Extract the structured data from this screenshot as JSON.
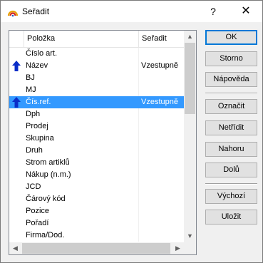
{
  "window": {
    "title": "Seřadit",
    "help": "?",
    "close": "✕"
  },
  "list": {
    "headers": {
      "item": "Položka",
      "sort": "Seřadit"
    },
    "rows": [
      {
        "item": "Číslo art.",
        "sort": "",
        "arrow": false,
        "selected": false
      },
      {
        "item": "Název",
        "sort": "Vzestupně",
        "arrow": true,
        "selected": false
      },
      {
        "item": "BJ",
        "sort": "",
        "arrow": false,
        "selected": false
      },
      {
        "item": "MJ",
        "sort": "",
        "arrow": false,
        "selected": false
      },
      {
        "item": "Čís.ref.",
        "sort": "Vzestupně",
        "arrow": true,
        "selected": true
      },
      {
        "item": "Dph",
        "sort": "",
        "arrow": false,
        "selected": false
      },
      {
        "item": "Prodej",
        "sort": "",
        "arrow": false,
        "selected": false
      },
      {
        "item": "Skupina",
        "sort": "",
        "arrow": false,
        "selected": false
      },
      {
        "item": "Druh",
        "sort": "",
        "arrow": false,
        "selected": false
      },
      {
        "item": "Strom artiklů",
        "sort": "",
        "arrow": false,
        "selected": false
      },
      {
        "item": "Nákup (n.m.)",
        "sort": "",
        "arrow": false,
        "selected": false
      },
      {
        "item": "JCD",
        "sort": "",
        "arrow": false,
        "selected": false
      },
      {
        "item": "Čárový kód",
        "sort": "",
        "arrow": false,
        "selected": false
      },
      {
        "item": "Pozice",
        "sort": "",
        "arrow": false,
        "selected": false
      },
      {
        "item": "Pořadí",
        "sort": "",
        "arrow": false,
        "selected": false
      },
      {
        "item": "Firma/Dod.",
        "sort": "",
        "arrow": false,
        "selected": false
      }
    ]
  },
  "buttons": {
    "ok": "OK",
    "storno": "Storno",
    "napoveda": "Nápověda",
    "oznacit": "Označit",
    "netridit": "Netřídit",
    "nahoru": "Nahoru",
    "dolu": "Dolů",
    "vychozi": "Výchozí",
    "ulozit": "Uložit"
  },
  "colors": {
    "selection": "#3399ff",
    "arrow": "#0a2dc8",
    "default_border": "#0078d7"
  }
}
